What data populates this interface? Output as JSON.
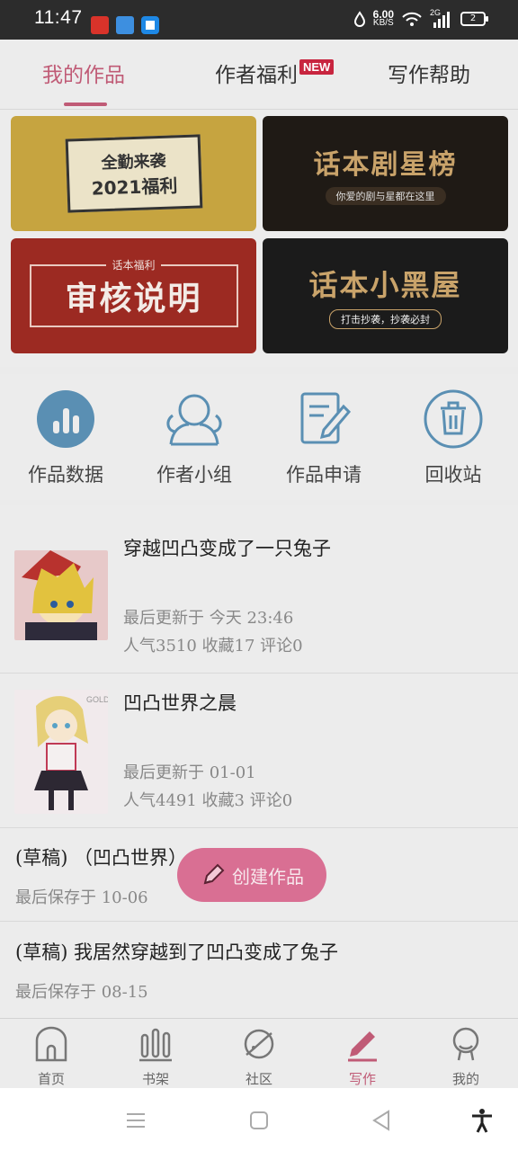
{
  "status_bar": {
    "time": "11:47",
    "net_speed_value": "6.00",
    "net_speed_unit": "KB/S",
    "network_type": "2G",
    "battery": "2"
  },
  "tabs": [
    {
      "label": "我的作品",
      "active": true
    },
    {
      "label": "作者福利",
      "badge": "NEW"
    },
    {
      "label": "写作帮助"
    }
  ],
  "banners": {
    "b1_line1": "全勤来袭",
    "b1_line2": "2021福利",
    "b2_title": "话本剧星榜",
    "b2_sub": "你爱的剧与星都在这里",
    "b3_tag": "话本福利",
    "b3_title": "审核说明",
    "b4_title": "话本小黑屋",
    "b4_sub": "打击抄袭，抄袭必封"
  },
  "quick_actions": [
    {
      "label": "作品数据",
      "icon": "bar-chart-icon"
    },
    {
      "label": "作者小组",
      "icon": "group-icon"
    },
    {
      "label": "作品申请",
      "icon": "edit-document-icon"
    },
    {
      "label": "回收站",
      "icon": "trash-icon"
    }
  ],
  "works": [
    {
      "title": "穿越凹凸变成了一只兔子",
      "updated": "最后更新于 今天 23:46",
      "stats": "人气3510 收藏17 评论0"
    },
    {
      "title": "凹凸世界之晨",
      "updated": "最后更新于 01-01",
      "stats": "人气4491 收藏3 评论0"
    }
  ],
  "drafts": [
    {
      "title": "(草稿) （凹凸世界）",
      "saved": "最后保存于 10-06"
    },
    {
      "title": "(草稿) 我居然穿越到了凹凸变成了兔子",
      "saved": "最后保存于 08-15"
    }
  ],
  "fab": {
    "label": "创建作品"
  },
  "bottom_nav": [
    {
      "label": "首页",
      "icon": "home-icon"
    },
    {
      "label": "书架",
      "icon": "bookshelf-icon"
    },
    {
      "label": "社区",
      "icon": "planet-icon"
    },
    {
      "label": "写作",
      "icon": "pen-icon",
      "active": true
    },
    {
      "label": "我的",
      "icon": "profile-icon"
    }
  ],
  "colors": {
    "accent": "#c05b76",
    "fab": "#d96f93",
    "icon_blue": "#5a8fb3"
  }
}
